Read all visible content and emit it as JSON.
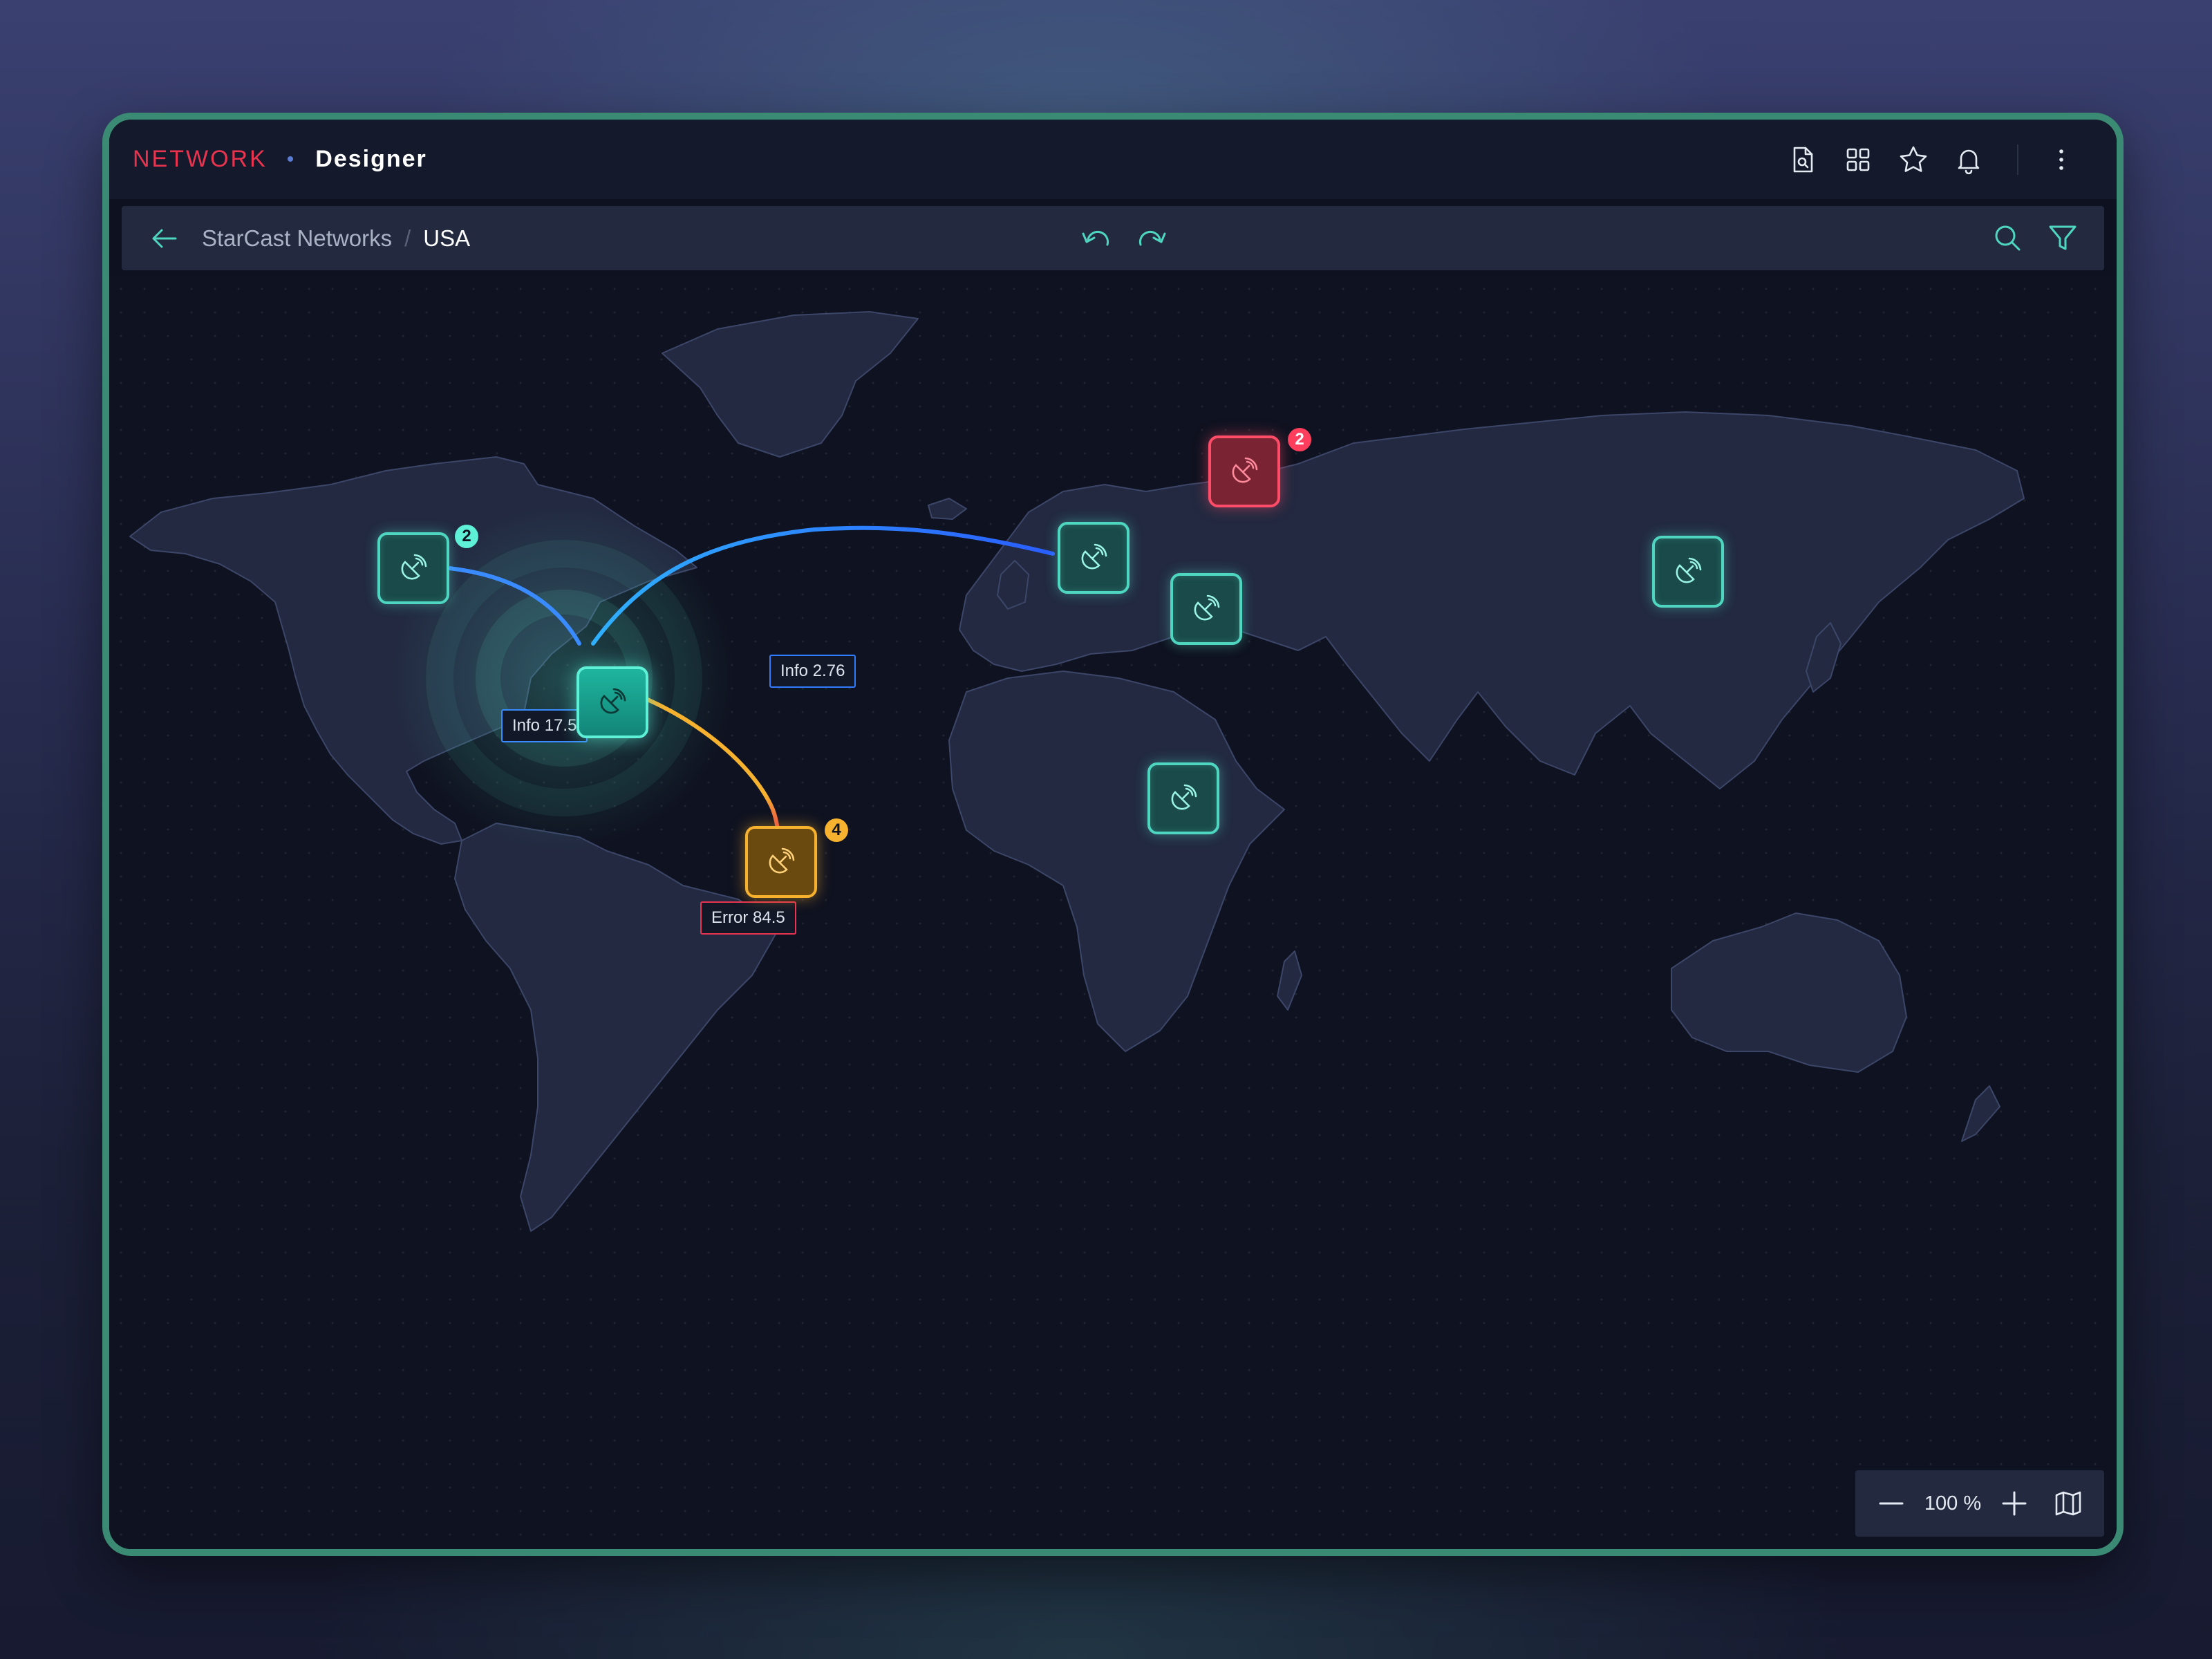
{
  "app": {
    "brand": "NETWORK",
    "separator": "•",
    "mode": "Designer"
  },
  "titlebar": {
    "icons": [
      "file-search-icon",
      "grid-icon",
      "star-icon",
      "bell-icon",
      "more-vertical-icon"
    ]
  },
  "toolbar": {
    "breadcrumb": {
      "parent": "StarCast Networks",
      "separator": "/",
      "current": "USA"
    },
    "icons": [
      "back-arrow-icon",
      "undo-icon",
      "redo-icon",
      "search-icon",
      "filter-icon"
    ]
  },
  "map": {
    "nodes": [
      {
        "id": "us-west",
        "status": "ok",
        "badge": "2",
        "icon": "satellite-dish-icon"
      },
      {
        "id": "us-central",
        "status": "active",
        "icon": "satellite-dish-icon"
      },
      {
        "id": "brazil",
        "status": "warning",
        "badge": "4",
        "icon": "satellite-dish-icon"
      },
      {
        "id": "western-europe",
        "status": "ok",
        "icon": "satellite-dish-icon"
      },
      {
        "id": "eastern-europe",
        "status": "ok",
        "icon": "satellite-dish-icon"
      },
      {
        "id": "russia",
        "status": "error",
        "badge": "2",
        "icon": "satellite-dish-icon"
      },
      {
        "id": "africa",
        "status": "ok",
        "icon": "satellite-dish-icon"
      },
      {
        "id": "china",
        "status": "ok",
        "icon": "satellite-dish-icon"
      }
    ],
    "links": [
      {
        "from": "us-west",
        "to": "us-central",
        "label": "Info 17.5",
        "color": "#3a8bff"
      },
      {
        "from": "us-central",
        "to": "western-europe",
        "label": "Info 2.76",
        "color": "#2f7cff"
      },
      {
        "from": "us-central",
        "to": "brazil",
        "label": "Error 84.5",
        "color": "#e8344f"
      }
    ],
    "colors": {
      "ok": "#4fd6c0",
      "error": "#ff4c68",
      "warning": "#f6b12e",
      "info": "#2f7cff"
    }
  },
  "zoom": {
    "value": "100 %",
    "icons": [
      "minus-icon",
      "plus-icon",
      "map-icon"
    ]
  }
}
